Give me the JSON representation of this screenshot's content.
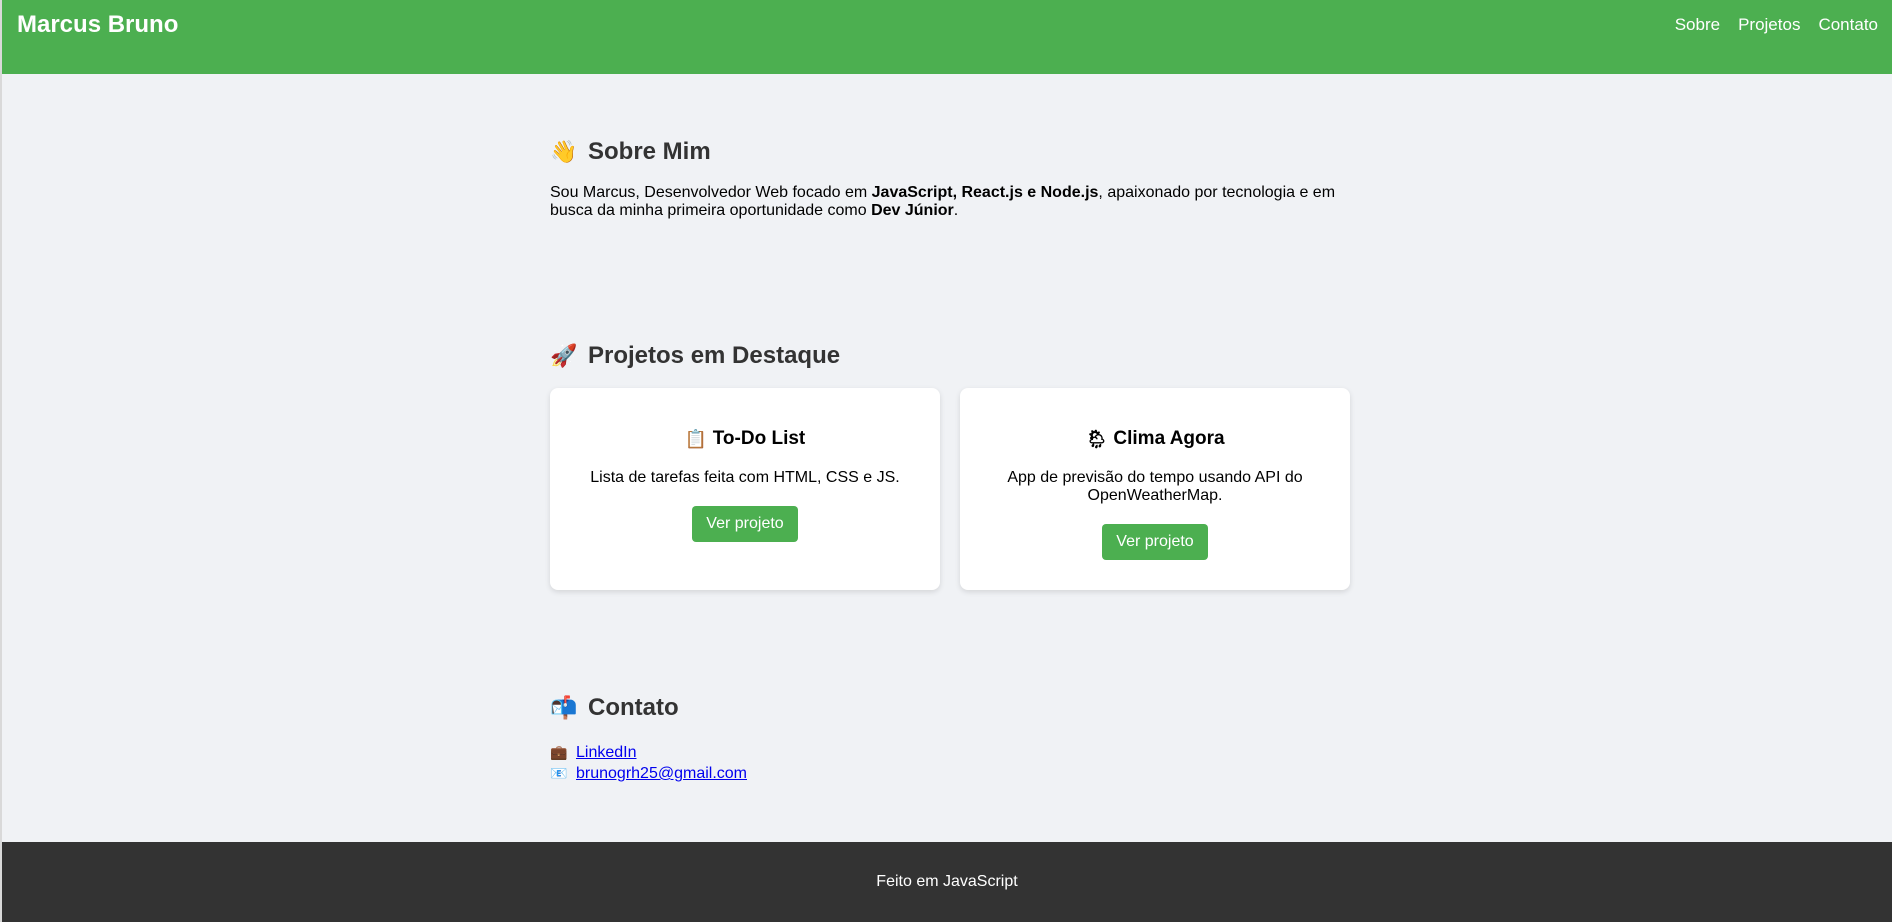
{
  "header": {
    "brand": "Marcus Bruno",
    "nav": [
      "Sobre",
      "Projetos",
      "Contato"
    ]
  },
  "sobre": {
    "icon": "waving-hand-icon",
    "emoji": "👋",
    "title": "Sobre Mim",
    "text_1": "Sou Marcus, Desenvolvedor Web focado em ",
    "bold_1": "JavaScript, React.js e Node.js",
    "text_2": ", apaixonado por tecnologia e em busca da minha primeira oportunidade como ",
    "bold_2": "Dev Júnior",
    "text_3": "."
  },
  "projetos": {
    "icon": "rocket-icon",
    "emoji": "🚀",
    "title": "Projetos em Destaque",
    "cards": [
      {
        "icon": "clipboard-icon",
        "emoji": "📋",
        "title": "To-Do List",
        "description": "Lista de tarefas feita com HTML, CSS e JS.",
        "button": "Ver projeto"
      },
      {
        "icon": "cloud-rain-icon",
        "emoji": "🌦",
        "title": "Clima Agora",
        "description": "App de previsão do tempo usando API do OpenWeatherMap.",
        "button": "Ver projeto"
      }
    ]
  },
  "contato": {
    "icon": "mailbox-icon",
    "emoji": "📬",
    "title": "Contato",
    "links": [
      {
        "icon": "briefcase-icon",
        "emoji": "💼",
        "label": "LinkedIn"
      },
      {
        "icon": "email-icon",
        "emoji": "📧",
        "label": "brunogrh25@gmail.com"
      }
    ]
  },
  "footer": {
    "text": "Feito em JavaScript"
  },
  "colors": {
    "accent": "#4caf50",
    "footer": "#333333",
    "background": "#f0f2f5"
  }
}
